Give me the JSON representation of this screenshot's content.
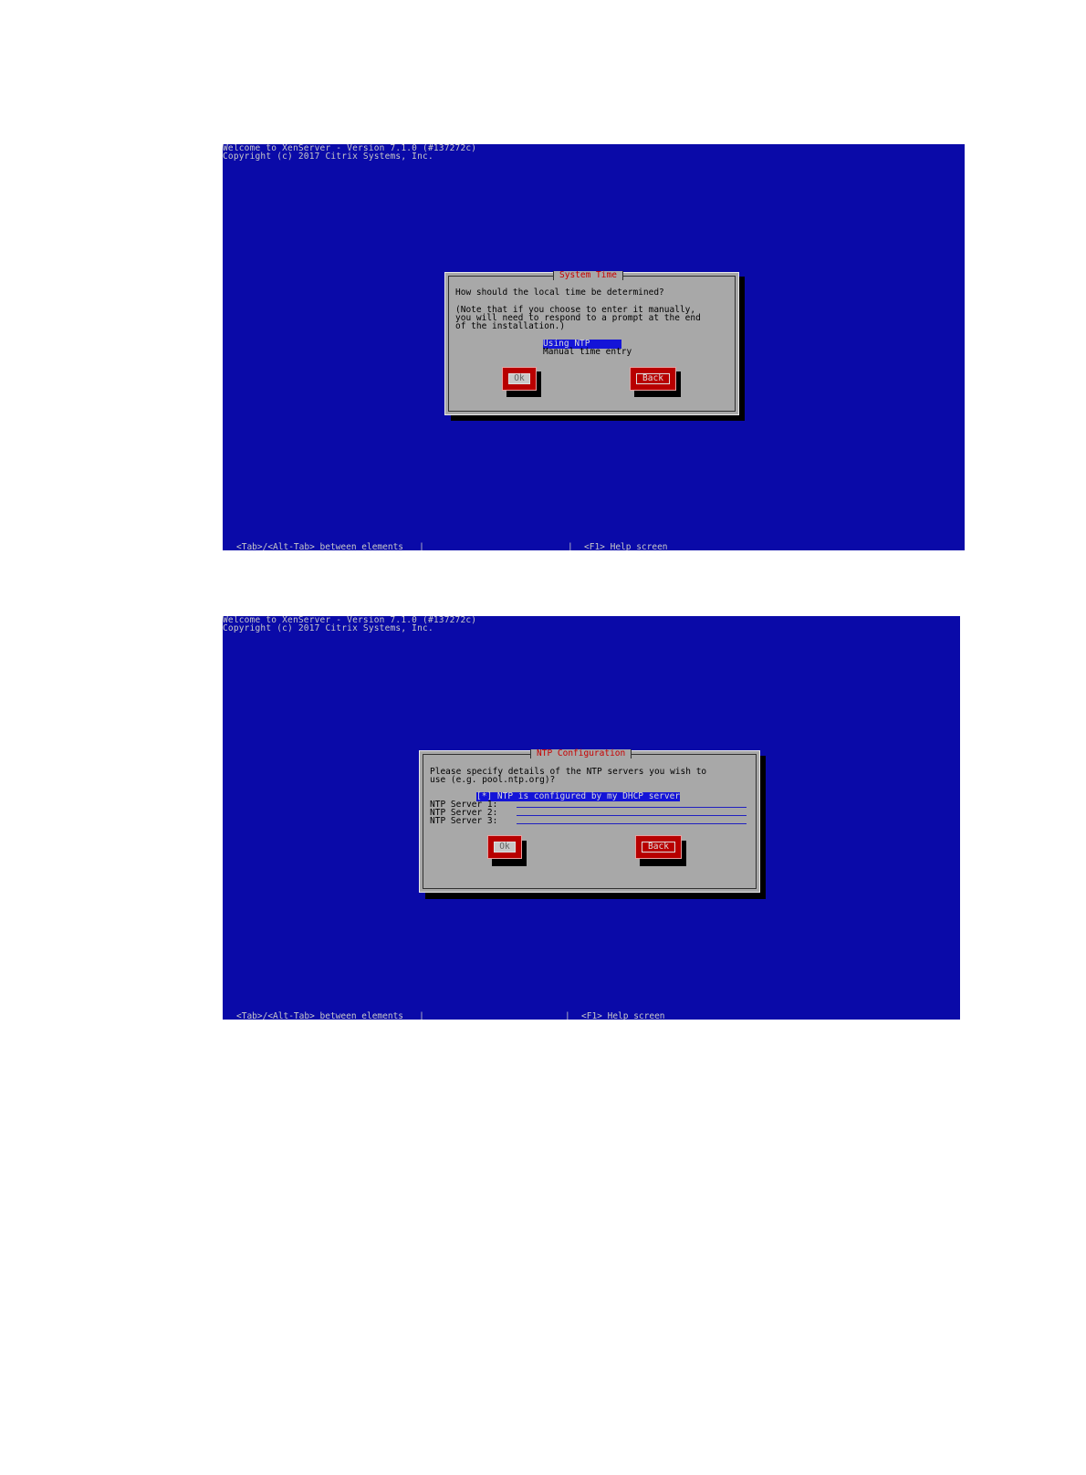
{
  "screen1": {
    "header_line1": "Welcome to XenServer - Version 7.1.0 (#137272c)",
    "header_line2": "Copyright (c) 2017 Citrix Systems, Inc.",
    "dialog": {
      "title": "System Time",
      "question": "How should the local time be determined?",
      "note_line1": "(Note that if you choose to enter it manually,",
      "note_line2": "you will need to respond to a prompt at the end",
      "note_line3": "of the installation.)",
      "options": [
        {
          "label": "Using NTP      ",
          "selected": true
        },
        {
          "label": "Manual time entry",
          "selected": false
        }
      ],
      "ok_label": "Ok",
      "back_label": "Back"
    },
    "footer": {
      "left": "<Tab>/<Alt-Tab> between elements   |",
      "mid": "|",
      "right": "<F1> Help screen"
    }
  },
  "screen2": {
    "header_line1": "Welcome to XenServer - Version 7.1.0 (#137272c)",
    "header_line2": "Copyright (c) 2017 Citrix Systems, Inc.",
    "dialog": {
      "title": "NTP Configuration",
      "prompt_line1": "Please specify details of the NTP servers you wish to",
      "prompt_line2": "use (e.g. pool.ntp.org)?",
      "dhcp_checkbox": "[*] NTP is configured by my DHCP server",
      "server1_label": "NTP Server 1:",
      "server2_label": "NTP Server 2:",
      "server3_label": "NTP Server 3:",
      "server1_value": "",
      "server2_value": "",
      "server3_value": "",
      "ok_label": "Ok",
      "back_label": "Back"
    },
    "footer": {
      "left": "<Tab>/<Alt-Tab> between elements   |",
      "mid": "|",
      "right": "<F1> Help screen"
    }
  }
}
